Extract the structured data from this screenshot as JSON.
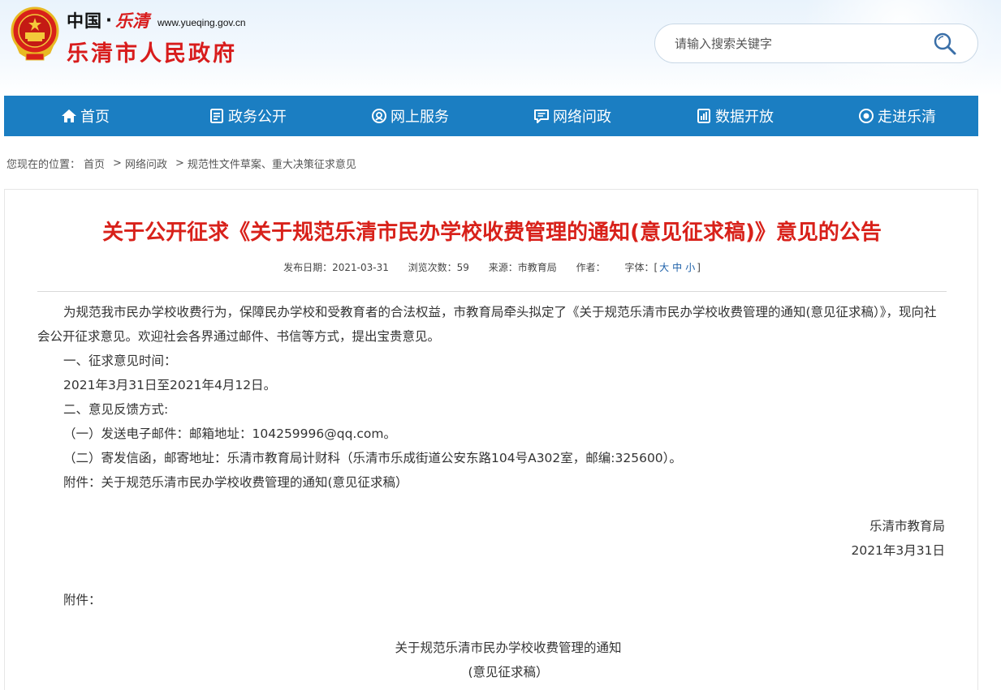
{
  "header": {
    "logo_cn": "中国",
    "logo_dot": "·",
    "logo_script": "乐清",
    "logo_url": "www.yueqing.gov.cn",
    "logo_main": "乐清市人民政府"
  },
  "search": {
    "placeholder": "请输入搜索关键字",
    "icon": "search-icon"
  },
  "nav": {
    "items": [
      {
        "label": "首页",
        "icon": "home-icon"
      },
      {
        "label": "政务公开",
        "icon": "document-icon"
      },
      {
        "label": "网上服务",
        "icon": "service-icon"
      },
      {
        "label": "网络问政",
        "icon": "message-icon"
      },
      {
        "label": "数据开放",
        "icon": "data-icon"
      },
      {
        "label": "走进乐清",
        "icon": "eye-icon"
      }
    ],
    "bg_color": "#1b7ec2"
  },
  "breadcrumb": {
    "prefix": "您现在的位置：",
    "items": [
      "首页",
      "网络问政",
      "规范性文件草案、重大决策征求意见"
    ],
    "sep": ">"
  },
  "article": {
    "title": "关于公开征求《关于规范乐清市民办学校收费管理的通知(意见征求稿)》意见的公告",
    "title_color": "#d8211a",
    "meta": {
      "date": "发布日期：2021-03-31",
      "views": "浏览次数：59",
      "source": "来源：市教育局",
      "author": "作者：",
      "fontsize_label": "字体：[",
      "fs_large": "大",
      "fs_medium": "中",
      "fs_small": "小",
      "fontsize_end": "]"
    },
    "paragraphs": [
      "为规范我市民办学校收费行为，保障民办学校和受教育者的合法权益，市教育局牵头拟定了《关于规范乐清市民办学校收费管理的通知(意见征求稿）》，现向社会公开征求意见。欢迎社会各界通过邮件、书信等方式，提出宝贵意见。",
      "一、征求意见时间：",
      "2021年3月31日至2021年4月12日。",
      "二、意见反馈方式:",
      "（一）发送电子邮件：邮箱地址：104259996@qq.com。",
      "（二）寄发信函，邮寄地址：乐清市教育局计财科（乐清市乐成街道公安东路104号A302室，邮编:325600）。",
      "附件：关于规范乐清市民办学校收费管理的通知(意见征求稿）"
    ],
    "signature_org": "乐清市教育局",
    "signature_date": "2021年3月31日",
    "attachment_label": "附件：",
    "attachment_title": "关于规范乐清市民办学校收费管理的通知",
    "attachment_subtitle": "(意见征求稿）"
  }
}
